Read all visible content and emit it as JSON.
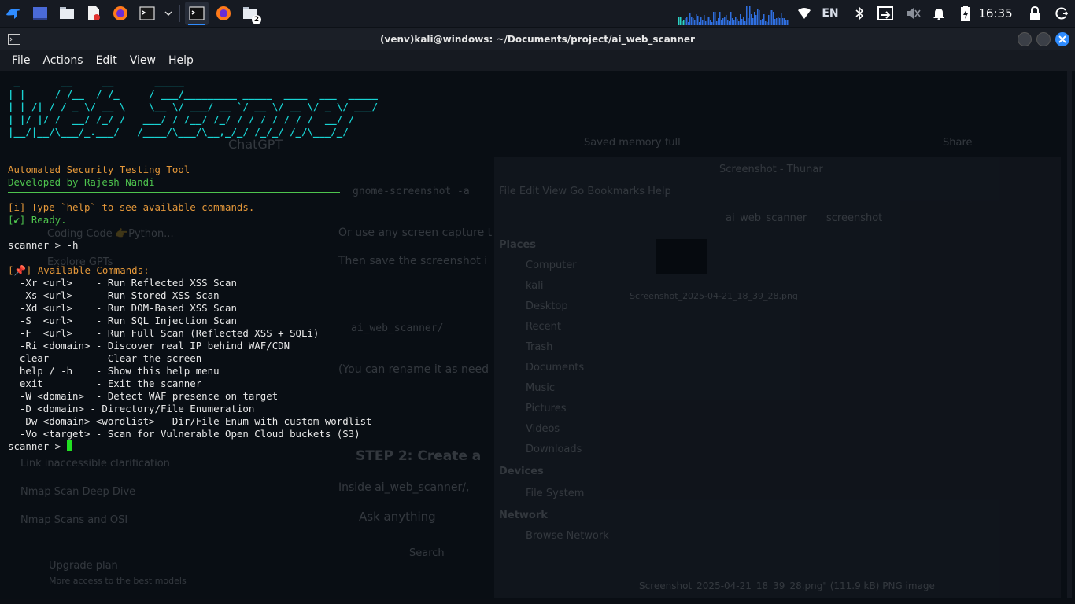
{
  "taskbar": {
    "launchers": [
      {
        "name": "kali-menu-icon"
      },
      {
        "name": "desktop-icon"
      },
      {
        "name": "file-manager-icon"
      },
      {
        "name": "text-editor-icon"
      },
      {
        "name": "firefox-icon"
      },
      {
        "name": "terminal-icon"
      }
    ],
    "tasks": [
      {
        "name": "terminal-task-icon"
      },
      {
        "name": "firefox-task-icon"
      },
      {
        "name": "folders-task-icon",
        "badge": "2"
      }
    ],
    "tray": {
      "language": "EN",
      "clock": "16:35"
    }
  },
  "window": {
    "title": "(venv)kali@windows: ~/Documents/project/ai_web_scanner",
    "menu": [
      "File",
      "Actions",
      "Edit",
      "View",
      "Help"
    ]
  },
  "terminal": {
    "banner": [
      " _       __     __       _____                                   ",
      "| |     / /__  / /_     / ___/_________ _____  ____  ___  _____  ",
      "| | /| / / _ \\/ __ \\    \\__ \\/ ___/ __ `/ __ \\/ __ \\/ _ \\/ ___/  ",
      "| |/ |/ /  __/ /_/ /   ___/ / /__/ /_/ / / / / / / /  __/ /      ",
      "|__/|__/\\___/_.___/   /____/\\___/\\__,_/_/ /_/_/ /_/\\___/_/       "
    ],
    "tagline": "Automated Security Testing Tool",
    "author": "Developed by Rajesh Nandi",
    "help_hint": "[i] Type `help` to see available commands.",
    "ready": "[✔] Ready.",
    "prompt_h": "scanner > -h",
    "available_prefix": "[",
    "available_pin": "📌",
    "available_suffix": "] Available Commands:",
    "commands": [
      "  -Xr <url>    - Run Reflected XSS Scan",
      "  -Xs <url>    - Run Stored XSS Scan",
      "  -Xd <url>    - Run DOM-Based XSS Scan",
      "  -S  <url>    - Run SQL Injection Scan",
      "  -F  <url>    - Run Full Scan (Reflected XSS + SQLi)",
      "  -Ri <domain> - Discover real IP behind WAF/CDN",
      "  clear        - Clear the screen",
      "  help / -h    - Show this help menu",
      "  exit         - Exit the scanner",
      "  -W <domain>  - Detect WAF presence on target",
      "  -D <domain> - Directory/File Enumeration",
      "  -Dw <domain> <wordlist> - Dir/File Enum with custom wordlist",
      "  -Vo <target> - Scan for Vulnerable Open Cloud buckets (S3)"
    ],
    "prompt": "scanner > "
  },
  "background": {
    "chat_title": "ChatGPT",
    "saved_memory": "Saved memory full",
    "share": "Share",
    "snippets": [
      "gnome-screenshot -a",
      "Or use any screen capture t",
      "Then save the screenshot i",
      "ai_web_scanner/",
      "(You can rename it as need",
      "STEP 2: Create a",
      "Inside ai_web_scanner/,",
      "Ask anything",
      "Search"
    ],
    "sidebar": [
      "Coding Code 👉Python...",
      "Explore GPTs",
      "Link inaccessible clarification",
      "Nmap Scan Deep Dive",
      "Nmap Scans and OSI",
      "Upgrade plan",
      "More access to the best models"
    ],
    "fm_title": "Screenshot - Thunar",
    "fm_menu": "File  Edit  View  Go  Bookmarks  Help",
    "fm_path": [
      "ai_web_scanner",
      "screenshot"
    ],
    "places_header": "Places",
    "places": [
      "Computer",
      "kali",
      "Desktop",
      "Recent",
      "Trash",
      "Documents",
      "Music",
      "Pictures",
      "Videos",
      "Downloads"
    ],
    "devices_header": "Devices",
    "devices": [
      "File System"
    ],
    "network_header": "Network",
    "network": [
      "Browse Network"
    ],
    "file_name": "Screenshot_2025-04-21_18_39_28.png",
    "status": "Screenshot_2025-04-21_18_39_28.png\" (111.9 kB) PNG image"
  }
}
